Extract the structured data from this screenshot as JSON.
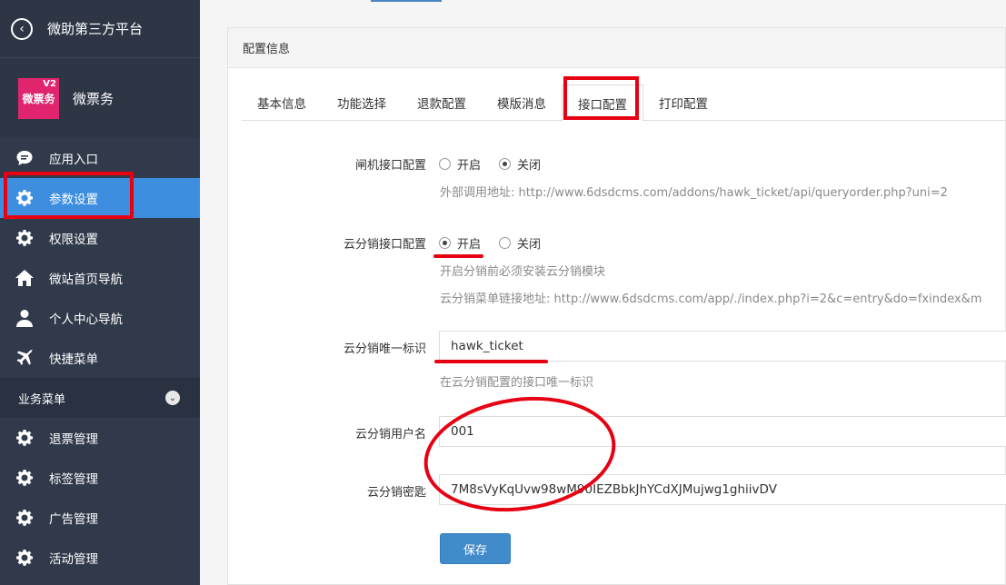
{
  "sidebar": {
    "title": "微助第三方平台",
    "app": {
      "logo_text": "微票务",
      "logo_badge": "V2",
      "name": "微票务"
    },
    "items": [
      {
        "label": "应用入口",
        "icon": "chat-icon"
      },
      {
        "label": "参数设置",
        "icon": "gear-icon"
      },
      {
        "label": "权限设置",
        "icon": "gear-icon"
      },
      {
        "label": "微站首页导航",
        "icon": "home-icon"
      },
      {
        "label": "个人中心导航",
        "icon": "user-icon"
      },
      {
        "label": "快捷菜单",
        "icon": "plane-icon"
      }
    ],
    "section": "业务菜单",
    "biz_items": [
      {
        "label": "退票管理",
        "icon": "gear-icon"
      },
      {
        "label": "标签管理",
        "icon": "gear-icon"
      },
      {
        "label": "广告管理",
        "icon": "gear-icon"
      },
      {
        "label": "活动管理",
        "icon": "gear-icon"
      }
    ]
  },
  "panel": {
    "title": "配置信息",
    "tabs": [
      "基本信息",
      "功能选择",
      "退款配置",
      "模版消息",
      "接口配置",
      "打印配置"
    ],
    "active_tab": "接口配置"
  },
  "form": {
    "gate": {
      "label": "闸机接口配置",
      "opt_on": "开启",
      "opt_off": "关闭",
      "selected": "关闭",
      "help": "外部调用地址: http://www.6dsdcms.com/addons/hawk_ticket/api/queryorder.php?uni=2"
    },
    "cloud": {
      "label": "云分销接口配置",
      "opt_on": "开启",
      "opt_off": "关闭",
      "selected": "开启",
      "help1": "开启分销前必须安装云分销模块",
      "help2": "云分销菜单链接地址: http://www.6dsdcms.com/app/./index.php?i=2&c=entry&do=fxindex&m"
    },
    "unique_id": {
      "label": "云分销唯一标识",
      "value": "hawk_ticket",
      "help": "在云分销配置的接口唯一标识"
    },
    "username": {
      "label": "云分销用户名",
      "value": "001"
    },
    "secret": {
      "label": "云分销密匙",
      "value": "7M8sVyKqUvw98wM90IEZBbkJhYCdXJMujwg1ghiivDV"
    },
    "save_label": "保存"
  },
  "colors": {
    "sidebar_bg": "#313a4b",
    "active_blue": "#3e8ee0",
    "annotation_red": "#e60012",
    "button_blue": "#428bca"
  }
}
